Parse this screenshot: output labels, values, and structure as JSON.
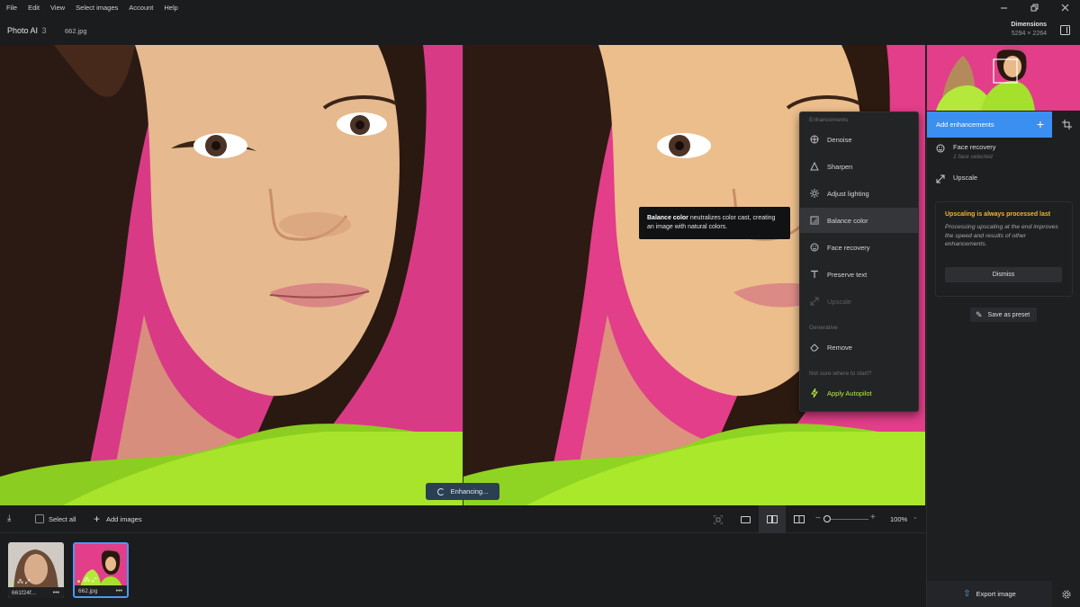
{
  "menubar": {
    "items": [
      "File",
      "Edit",
      "View",
      "Select images",
      "Account",
      "Help"
    ]
  },
  "titlebar": {
    "app_name": "Photo AI",
    "app_version": "3",
    "file_name": "662.jpg",
    "dimensions_label": "Dimensions",
    "dimensions_value": "5294 × 2264"
  },
  "preview": {
    "status": "Enhancing..."
  },
  "enhancements_menu": {
    "section_enhancements": "Enhancements",
    "items": [
      {
        "label": "Denoise",
        "icon": "denoise-icon",
        "state": "normal"
      },
      {
        "label": "Sharpen",
        "icon": "sharpen-icon",
        "state": "normal"
      },
      {
        "label": "Adjust lighting",
        "icon": "lighting-icon",
        "state": "normal"
      },
      {
        "label": "Balance color",
        "icon": "balance-color-icon",
        "state": "hover"
      },
      {
        "label": "Face recovery",
        "icon": "face-icon",
        "state": "normal"
      },
      {
        "label": "Preserve text",
        "icon": "text-icon",
        "state": "normal"
      },
      {
        "label": "Upscale",
        "icon": "upscale-icon",
        "state": "disabled"
      }
    ],
    "section_generative": "Generative",
    "remove_label": "Remove",
    "hint": "Not sure where to start?",
    "autopilot_label": "Apply Autopilot"
  },
  "tooltip": {
    "bold": "Balance color",
    "text": " neutralizes color cast, creating an image with natural colors."
  },
  "right_panel": {
    "add_enhancements": "Add enhancements",
    "face_recovery_title": "Face recovery",
    "face_recovery_sub": "1 face selected",
    "upscale_title": "Upscale",
    "notice_title": "Upscaling is always processed last",
    "notice_body": "Processing upscaling at the end improves the speed and results of other enhancements.",
    "dismiss": "Dismiss",
    "save_preset": "Save as preset",
    "export": "Export image"
  },
  "toolbar": {
    "select_all": "Select all",
    "add_images": "Add images",
    "zoom": "100%",
    "zoom_level": 0.05
  },
  "filmstrip": {
    "items": [
      {
        "name": "661f24f...",
        "selected": false
      },
      {
        "name": "662.jpg",
        "selected": true
      }
    ]
  },
  "colors": {
    "accent": "#3a8ff0",
    "autopilot": "#b9f23a",
    "warning": "#f0b533",
    "background": "#d93a86"
  }
}
